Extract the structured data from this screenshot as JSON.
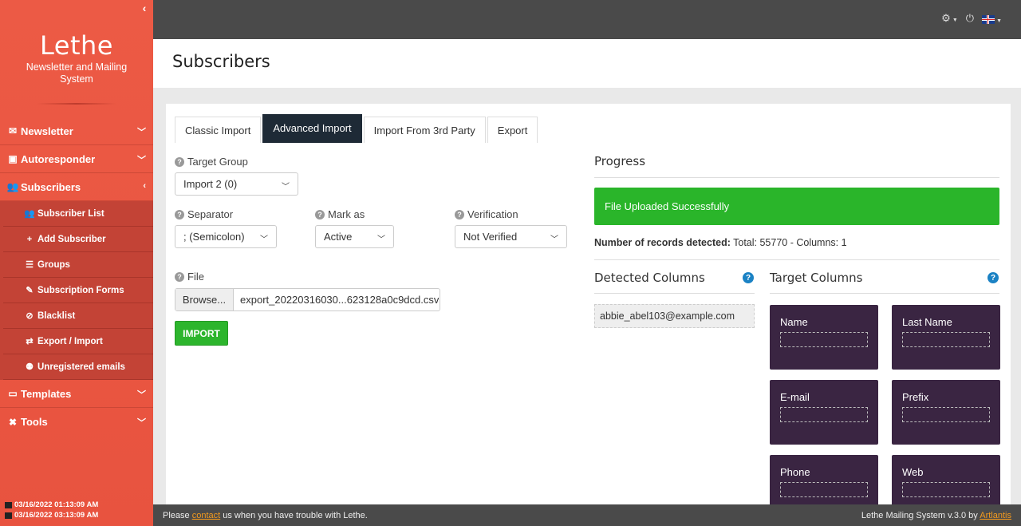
{
  "sidebar": {
    "brand_title": "Lethe",
    "brand_subtitle": "Newsletter and Mailing System",
    "nav": [
      {
        "label": "Newsletter",
        "icon": "envelope-icon"
      },
      {
        "label": "Autoresponder",
        "icon": "robot-icon"
      },
      {
        "label": "Subscribers",
        "icon": "users-icon"
      }
    ],
    "subnav": [
      {
        "label": "Subscriber List",
        "icon": "users-icon"
      },
      {
        "label": "Add Subscriber",
        "icon": "plus-icon"
      },
      {
        "label": "Groups",
        "icon": "list-icon"
      },
      {
        "label": "Subscription Forms",
        "icon": "edit-icon"
      },
      {
        "label": "Blacklist",
        "icon": "ban-icon"
      },
      {
        "label": "Export / Import",
        "icon": "exchange-icon"
      },
      {
        "label": "Unregistered emails",
        "icon": "user-slash-icon"
      }
    ],
    "nav_bottom": [
      {
        "label": "Templates",
        "icon": "paint-roller-icon"
      },
      {
        "label": "Tools",
        "icon": "tools-icon"
      }
    ],
    "times": [
      "03/16/2022 01:13:09 AM",
      "03/16/2022 03:13:09 AM"
    ]
  },
  "page": {
    "title": "Subscribers"
  },
  "tabs": [
    "Classic Import",
    "Advanced Import",
    "Import From 3rd Party",
    "Export"
  ],
  "form": {
    "target_group_label": "Target Group",
    "target_group_value": "Import 2 (0)",
    "separator_label": "Separator",
    "separator_value": "; (Semicolon)",
    "mark_as_label": "Mark as",
    "mark_as_value": "Active",
    "verification_label": "Verification",
    "verification_value": "Not Verified",
    "file_label": "File",
    "browse_label": "Browse...",
    "file_name": "export_20220316030...623128a0c9dcd.csv",
    "import_button": "IMPORT"
  },
  "progress": {
    "title": "Progress",
    "message": "File Uploaded Successfully",
    "records_label": "Number of records detected:",
    "records_value": "Total: 55770 - Columns: 1"
  },
  "columns": {
    "detected_title": "Detected Columns",
    "target_title": "Target Columns",
    "detected_items": [
      "abbie_abel103@example.com"
    ],
    "targets": [
      "Name",
      "Last Name",
      "E-mail",
      "Prefix",
      "Phone",
      "Web"
    ]
  },
  "footer": {
    "left_prefix": "Please",
    "left_link": "contact",
    "left_suffix": "us when you have trouble with Lethe.",
    "right_text": "Lethe Mailing System v.3.0 by",
    "right_link": "Artlantis"
  },
  "colors": {
    "sidebar": "#e8533f",
    "active_tab": "#1e2a36",
    "success": "#2ab52a",
    "target_box": "#3a2542",
    "link": "#f39a1e"
  }
}
